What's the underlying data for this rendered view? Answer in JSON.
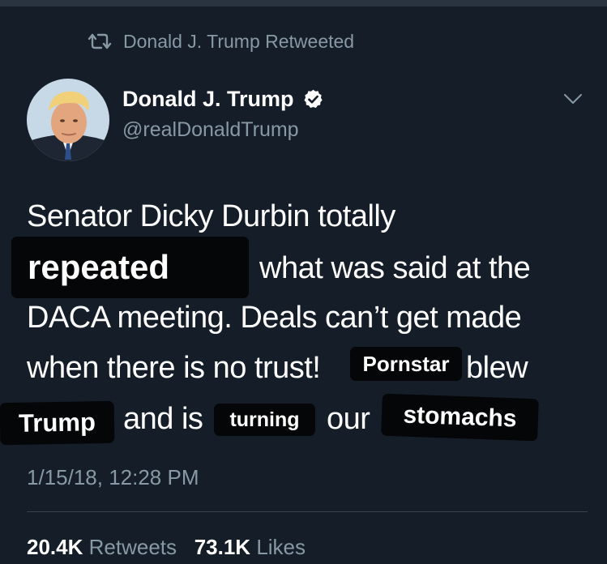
{
  "retweet_header": {
    "text": "Donald J. Trump Retweeted",
    "icon": "retweet-icon"
  },
  "author": {
    "name": "Donald J. Trump",
    "handle": "@realDonaldTrump",
    "verified_icon": "verified-badge-icon"
  },
  "menu_icon": "chevron-down-icon",
  "tweet": {
    "line1": "Senator Dicky Durbin totally",
    "line2_rest": "what was said at the",
    "line3": "DACA meeting. Deals can’t get made",
    "line4_start": "when there is no trust!",
    "line4_end": "blew",
    "line5_middle": "and is",
    "line5_mid2": "our"
  },
  "stickers": {
    "repeated": "repeated",
    "pornstar": "Pornstar",
    "trump": "Trump",
    "turning": "turning",
    "stomachs": "stomachs"
  },
  "timestamp": "1/15/18, 12:28 PM",
  "stats": {
    "retweets_count": "20.4K",
    "retweets_label": "Retweets",
    "likes_count": "73.1K",
    "likes_label": "Likes"
  },
  "colors": {
    "background": "#141d28",
    "secondary_text": "#8899a6",
    "redaction_box": "#050607",
    "verified_badge": "#ffffff"
  }
}
